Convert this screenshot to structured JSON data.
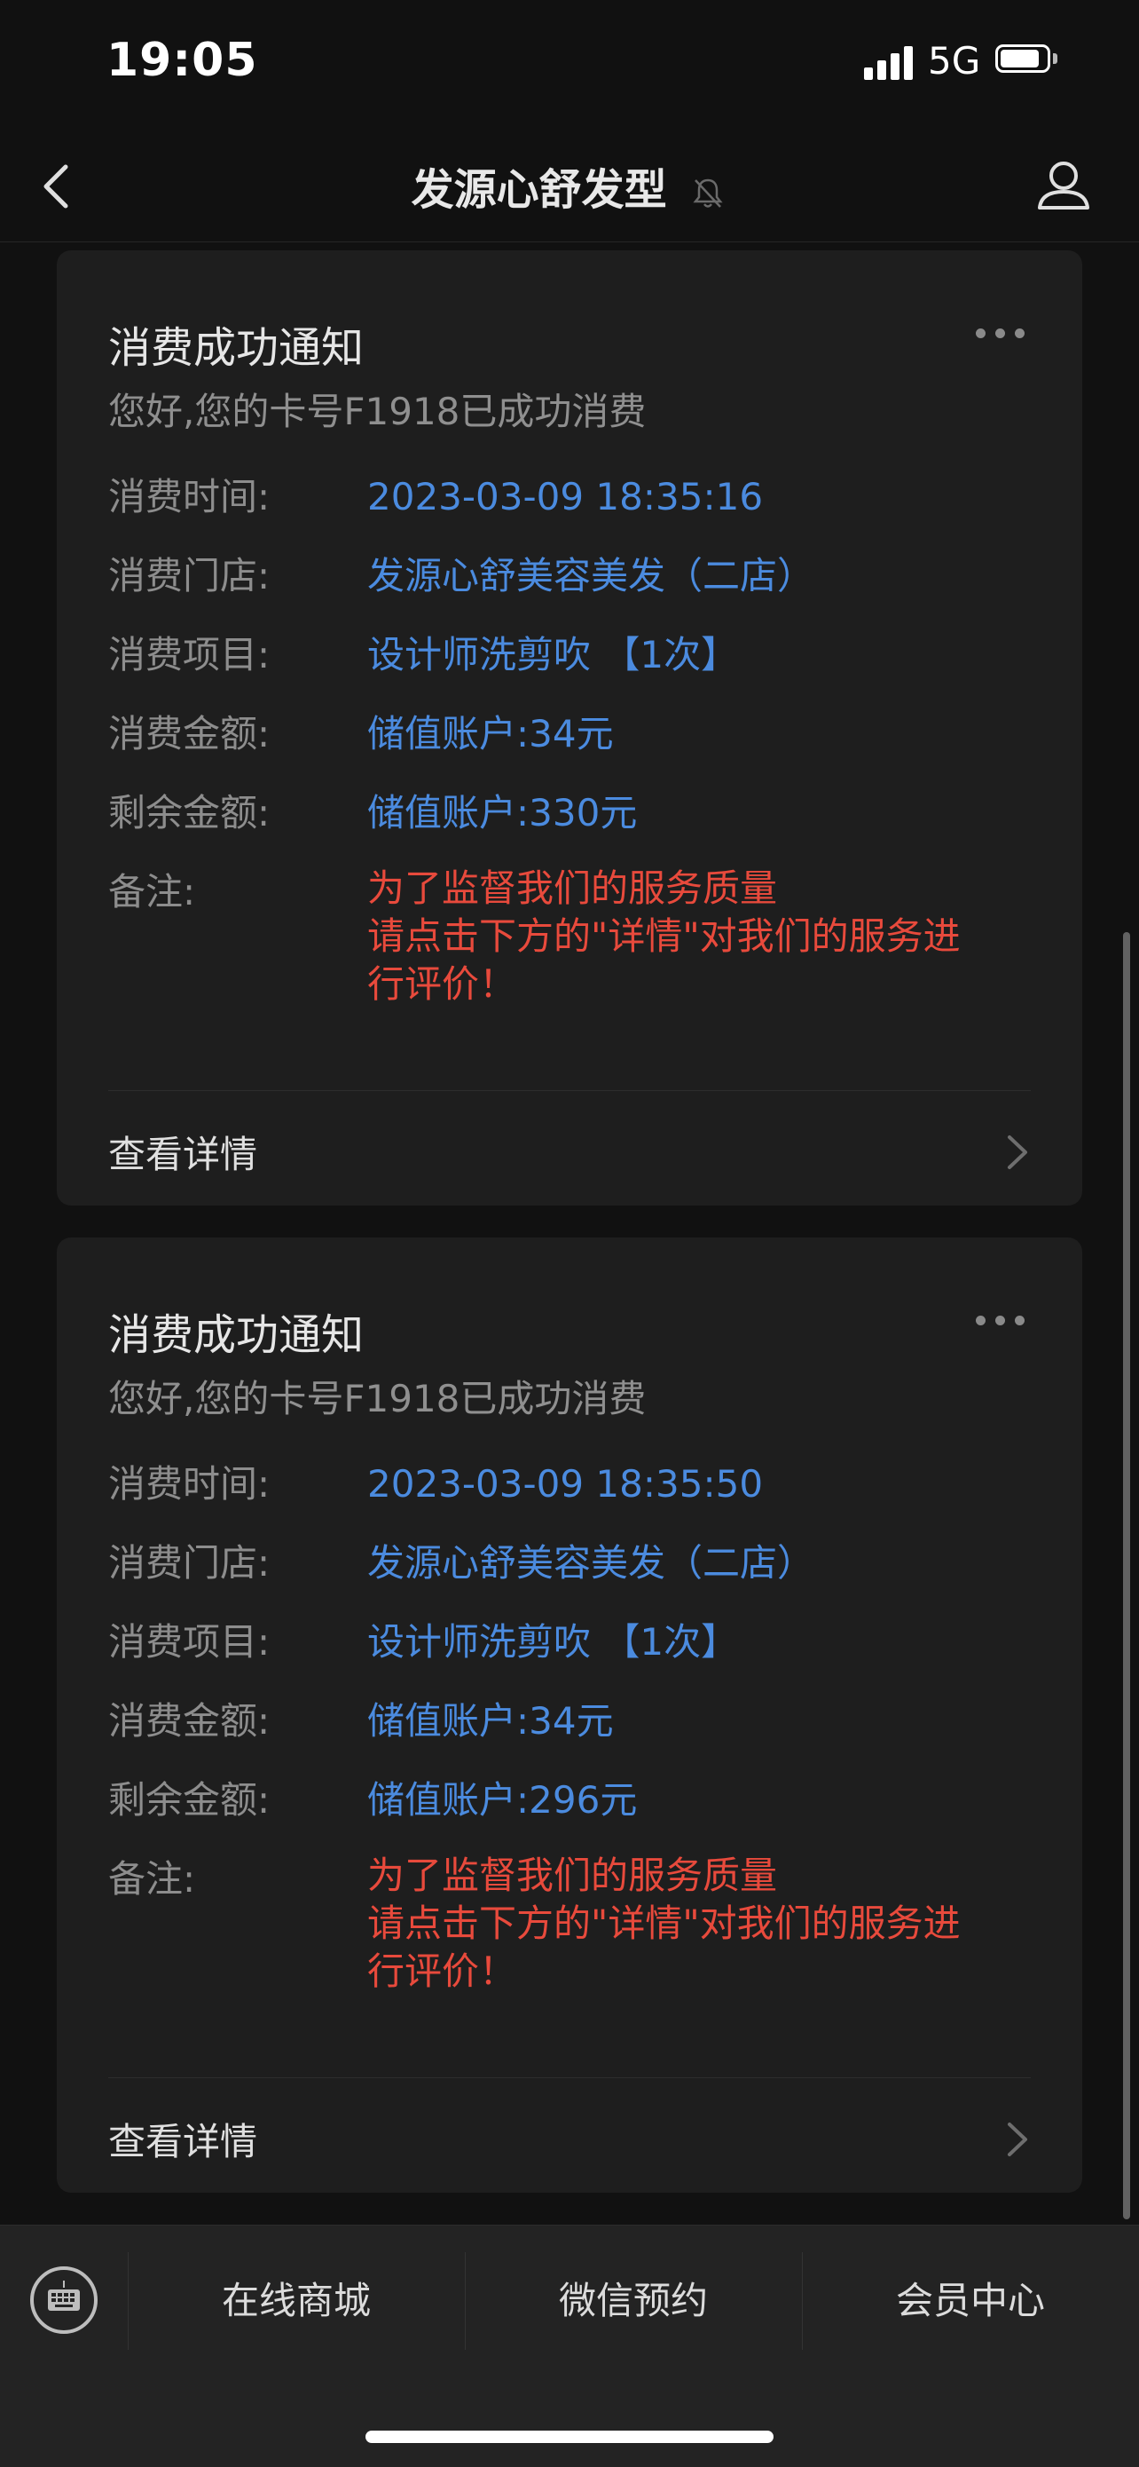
{
  "status_bar": {
    "time": "19:05",
    "network": "5G",
    "battery_level": 0.85
  },
  "nav": {
    "title": "发源心舒发型",
    "back_icon": "chevron-left-icon",
    "mute_icon": "bell-off-icon",
    "profile_icon": "person-icon"
  },
  "cards": [
    {
      "title": "消费成功通知",
      "subtitle": "您好,您的卡号F1918已成功消费",
      "rows": [
        {
          "label": "消费时间:",
          "value": "2023-03-09 18:35:16"
        },
        {
          "label": "消费门店:",
          "value": "发源心舒美容美发（二店）"
        },
        {
          "label": "消费项目:",
          "value": "设计师洗剪吹 【1次】"
        },
        {
          "label": "消费金额:",
          "value": "储值账户:34元"
        },
        {
          "label": "剩余金额:",
          "value": "储值账户:330元"
        }
      ],
      "remark_label": "备注:",
      "remark_lines": [
        "为了监督我们的服务质量",
        "请点击下方的\"详情\"对我们的服务进",
        "行评价！"
      ],
      "detail_label": "查看详情"
    },
    {
      "title": "消费成功通知",
      "subtitle": "您好,您的卡号F1918已成功消费",
      "rows": [
        {
          "label": "消费时间:",
          "value": "2023-03-09 18:35:50"
        },
        {
          "label": "消费门店:",
          "value": "发源心舒美容美发（二店）"
        },
        {
          "label": "消费项目:",
          "value": "设计师洗剪吹 【1次】"
        },
        {
          "label": "消费金额:",
          "value": "储值账户:34元"
        },
        {
          "label": "剩余金额:",
          "value": "储值账户:296元"
        }
      ],
      "remark_label": "备注:",
      "remark_lines": [
        "为了监督我们的服务质量",
        "请点击下方的\"详情\"对我们的服务进",
        "行评价！"
      ],
      "detail_label": "查看详情"
    }
  ],
  "bottom_menu": {
    "keyboard_icon": "keyboard-icon",
    "items": [
      "在线商城",
      "微信预约",
      "会员中心"
    ]
  },
  "colors": {
    "background": "#111111",
    "card": "#1e1e1e",
    "link_blue": "#4b8bdf",
    "remark_red": "#e84a3c"
  }
}
